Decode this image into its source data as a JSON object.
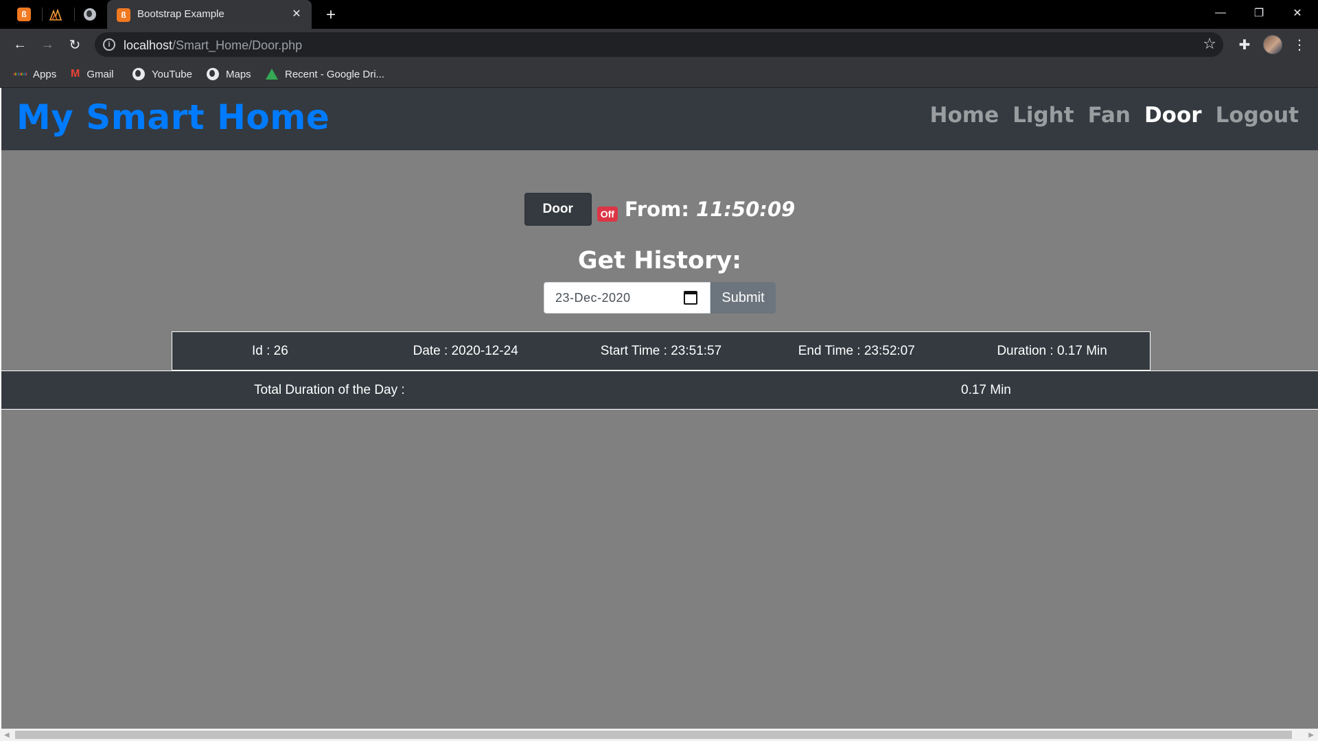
{
  "browser": {
    "tab_title": "Bootstrap Example",
    "url_host": "localhost",
    "url_path": "/Smart_Home/Door.php",
    "bookmarks": [
      {
        "label": "Apps",
        "icon": "apps-grid-icon"
      },
      {
        "label": "Gmail",
        "icon": "gmail-icon"
      },
      {
        "label": "YouTube",
        "icon": "globe-icon"
      },
      {
        "label": "Maps",
        "icon": "globe-icon"
      },
      {
        "label": "Recent - Google Dri...",
        "icon": "google-drive-icon"
      }
    ]
  },
  "navbar": {
    "brand": "My Smart Home",
    "links": [
      "Home",
      "Light",
      "Fan",
      "Door",
      "Logout"
    ],
    "active": "Door",
    "brand_color": "#007bff",
    "bg_color": "#343a40"
  },
  "status": {
    "device_label": "Door",
    "state_badge": "Off",
    "from_label": "From:",
    "from_time": "11:50:09",
    "badge_color": "#dc3545"
  },
  "history": {
    "title": "Get History:",
    "date_value": "23-Dec-2020",
    "submit_label": "Submit"
  },
  "records": [
    {
      "id": "Id : 26",
      "date": "Date : 2020-12-24",
      "start": "Start Time : 23:51:57",
      "end": "End Time : 23:52:07",
      "duration": "Duration : 0.17 Min"
    }
  ],
  "total": {
    "label": "Total Duration of the Day :",
    "value": "0.17 Min"
  }
}
